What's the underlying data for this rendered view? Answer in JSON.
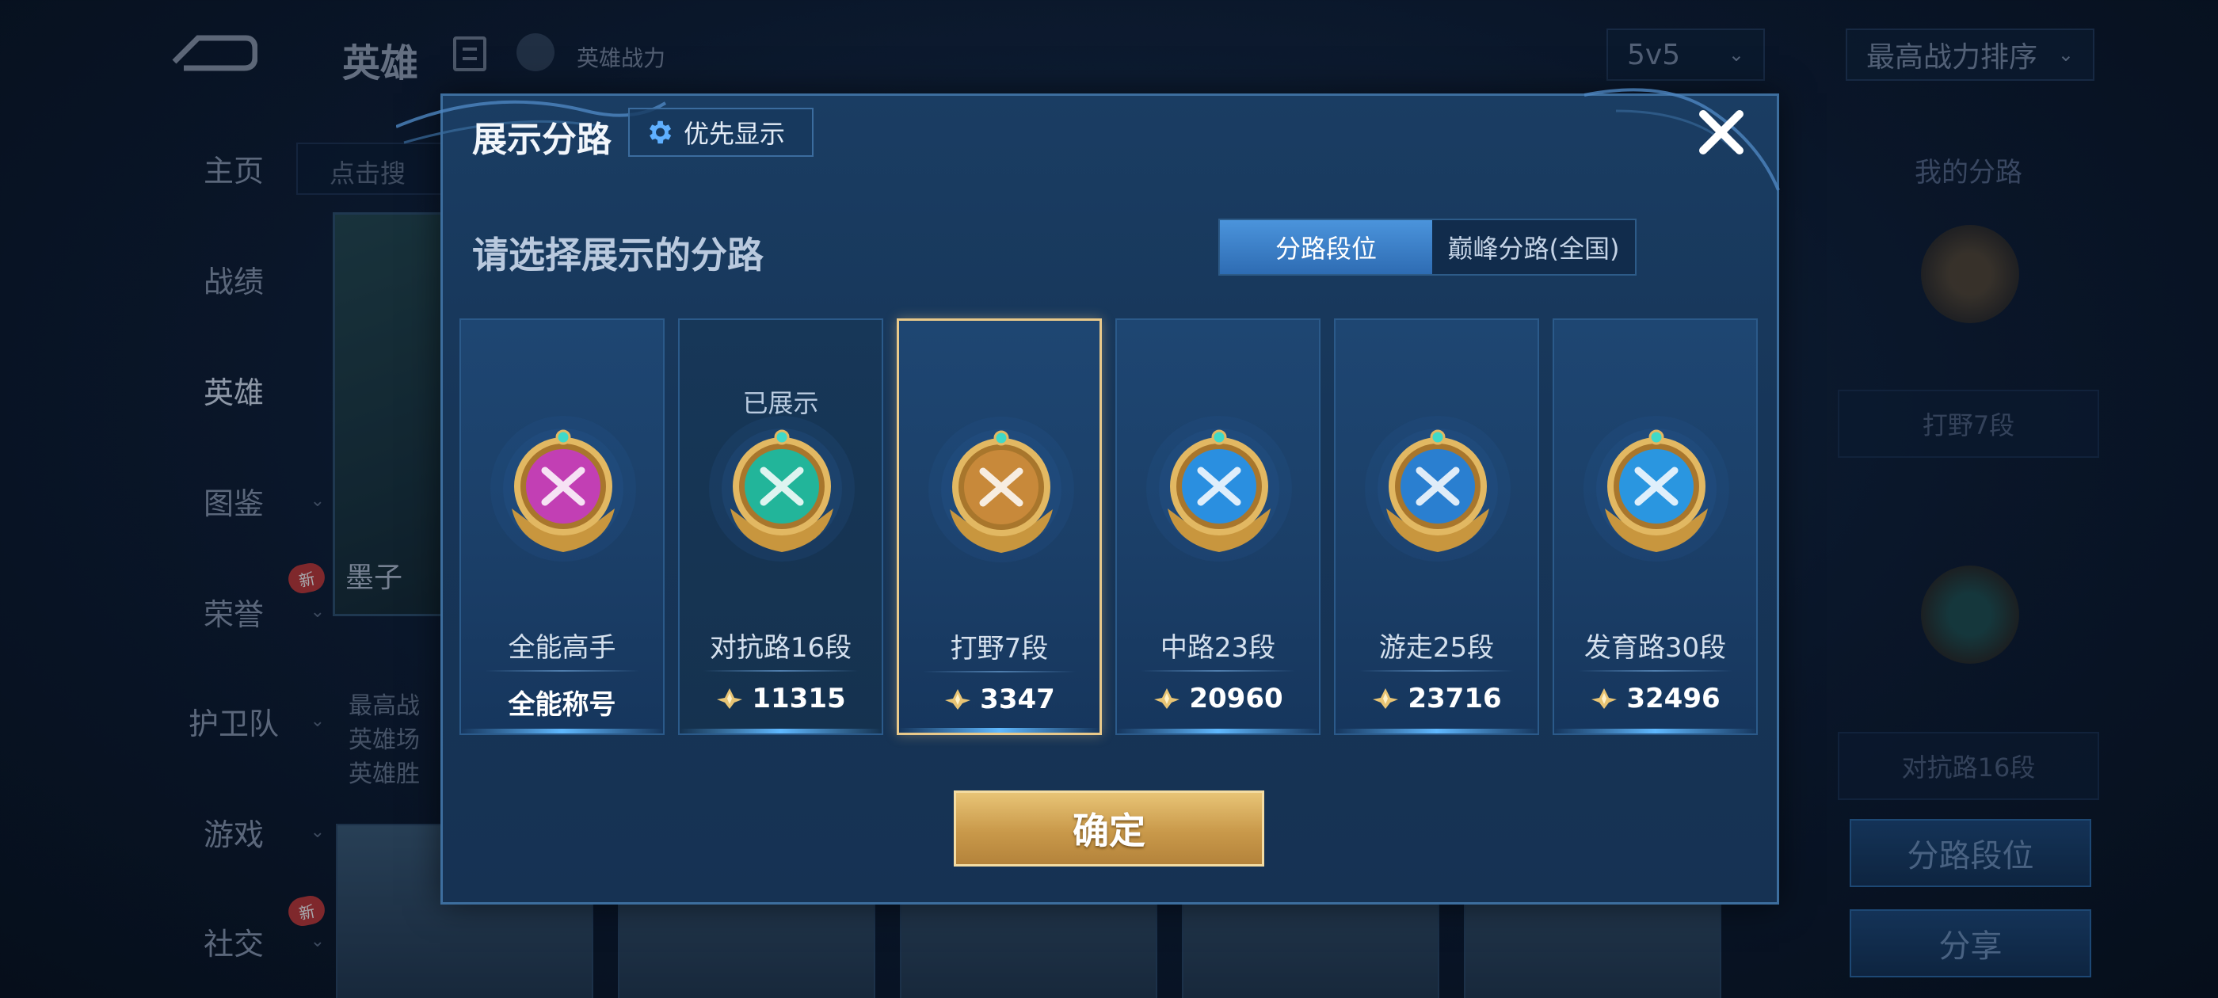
{
  "background": {
    "title": "英雄",
    "power_label": "英雄战力",
    "mode_select": "5v5",
    "sort_select": "最高战力排序",
    "search_placeholder": "点击搜",
    "nav": [
      {
        "label": "主页"
      },
      {
        "label": "战绩"
      },
      {
        "label": "英雄"
      },
      {
        "label": "图鉴"
      },
      {
        "label": "荣誉"
      },
      {
        "label": "护卫队"
      },
      {
        "label": "游戏"
      },
      {
        "label": "社交"
      }
    ],
    "new_badge": "新",
    "hero_name": "墨子",
    "hero_info": [
      "最高战",
      "英雄场",
      "英雄胜"
    ],
    "right_panel": {
      "title": "我的分路",
      "lane1": "打野7段",
      "lane2": "对抗路16段",
      "lane_rank_button": "分路段位",
      "share_button": "分享"
    }
  },
  "modal": {
    "title": "展示分路",
    "priority_button": "优先显示",
    "subtitle": "请选择展示的分路",
    "tabs": [
      "分路段位",
      "巅峰分路(全国)"
    ],
    "shown_label": "已展示",
    "confirm": "确定",
    "lanes": [
      {
        "name": "全能高手",
        "score": "全能称号",
        "medal_color": "#c23fb4",
        "shown": false,
        "selected": false
      },
      {
        "name": "对抗路16段",
        "score": "11315",
        "medal_color": "#22b59a",
        "shown": true,
        "selected": false
      },
      {
        "name": "打野7段",
        "score": "3347",
        "medal_color": "#c8893a",
        "shown": false,
        "selected": true
      },
      {
        "name": "中路23段",
        "score": "20960",
        "medal_color": "#2a8fe0",
        "shown": false,
        "selected": false
      },
      {
        "name": "游走25段",
        "score": "23716",
        "medal_color": "#2a7fd0",
        "shown": false,
        "selected": false
      },
      {
        "name": "发育路30段",
        "score": "32496",
        "medal_color": "#2a96e0",
        "shown": false,
        "selected": false
      }
    ]
  }
}
